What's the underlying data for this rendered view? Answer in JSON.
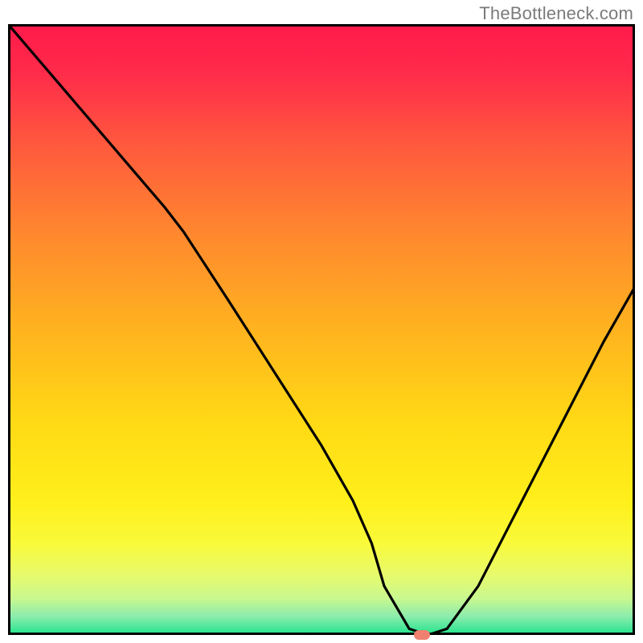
{
  "watermark": "TheBottleneck.com",
  "chart_data": {
    "type": "line",
    "title": "",
    "xlabel": "",
    "ylabel": "",
    "xlim": [
      0,
      100
    ],
    "ylim": [
      0,
      100
    ],
    "grid": false,
    "legend": false,
    "annotations": [],
    "series": [
      {
        "name": "bottleneck-curve",
        "x": [
          0,
          5,
          10,
          15,
          20,
          25,
          28,
          35,
          40,
          45,
          50,
          55,
          58,
          60,
          64,
          67,
          70,
          75,
          80,
          85,
          90,
          95,
          100
        ],
        "y": [
          100,
          94,
          88,
          82,
          76,
          70,
          66,
          55,
          47,
          39,
          31,
          22,
          15,
          8,
          1,
          0,
          1,
          8,
          18,
          28,
          38,
          48,
          57
        ]
      }
    ],
    "optimal_marker": {
      "x": 66,
      "y": 0
    },
    "background_gradient_stops": [
      {
        "offset": 0.0,
        "color": "#ff1a4b"
      },
      {
        "offset": 0.08,
        "color": "#ff2b4a"
      },
      {
        "offset": 0.2,
        "color": "#ff5a3d"
      },
      {
        "offset": 0.35,
        "color": "#ff8a2e"
      },
      {
        "offset": 0.5,
        "color": "#ffb31f"
      },
      {
        "offset": 0.65,
        "color": "#ffd915"
      },
      {
        "offset": 0.78,
        "color": "#ffef1a"
      },
      {
        "offset": 0.85,
        "color": "#f9fa3a"
      },
      {
        "offset": 0.9,
        "color": "#e8fa6a"
      },
      {
        "offset": 0.94,
        "color": "#c9f88f"
      },
      {
        "offset": 0.97,
        "color": "#8becad"
      },
      {
        "offset": 1.0,
        "color": "#1fe38b"
      }
    ]
  },
  "colors": {
    "frame_border": "#000000",
    "curve": "#000000",
    "marker": "#f08070",
    "watermark": "#7a7a7a"
  }
}
